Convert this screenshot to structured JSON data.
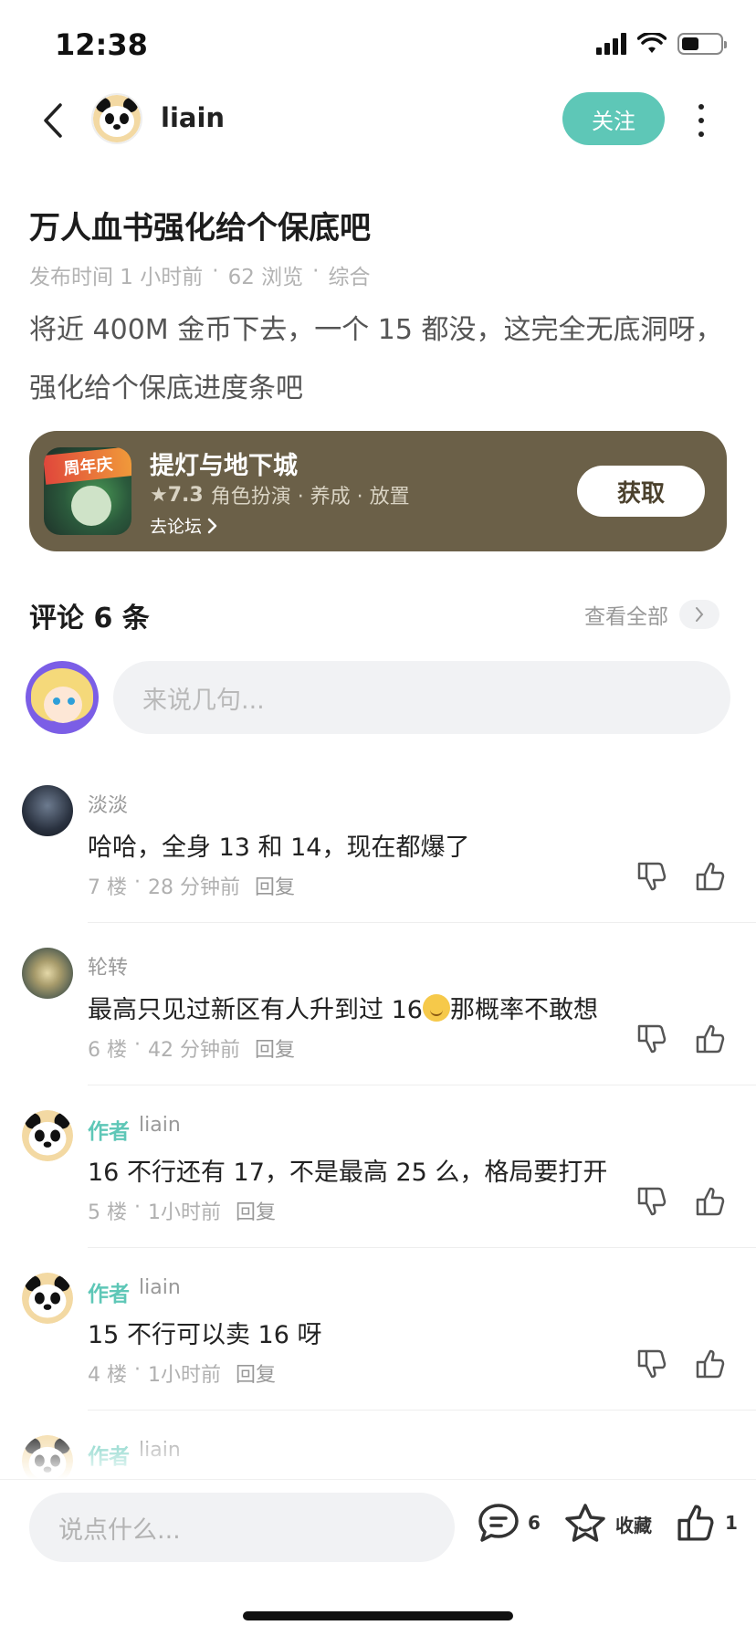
{
  "status_bar": {
    "time": "12:38"
  },
  "header": {
    "author_name": "liain",
    "follow_label": "关注"
  },
  "post": {
    "title": "万人血书强化给个保底吧",
    "meta": {
      "published": "发布时间 1 小时前",
      "views": "62 浏览",
      "category": "综合",
      "separator": "·"
    },
    "body": "将近 400M 金币下去，一个 15 都没，这完全无底洞呀，强化给个保底进度条吧"
  },
  "game_card": {
    "icon_badge": "周年庆",
    "name": "提灯与地下城",
    "rating": "★7.3",
    "tags": "角色扮演 · 养成 · 放置",
    "forum_link": "去论坛",
    "get_label": "获取",
    "background_color": "#6b6048"
  },
  "comments_section": {
    "title": "评论 6 条",
    "view_all": "查看全部",
    "input_placeholder": "来说几句..."
  },
  "comments": [
    {
      "name": "淡淡",
      "is_author": false,
      "text": "哈哈，全身 13 和 14，现在都爆了",
      "floor": "7 楼",
      "time": "28 分钟前",
      "reply": "回复"
    },
    {
      "name": "轮转",
      "is_author": false,
      "text_before": "最高只见过新区有人升到过 16",
      "text_after": "那概率不敢想",
      "floor": "6 楼",
      "time": "42 分钟前",
      "reply": "回复"
    },
    {
      "author_tag": "作者",
      "name": "liain",
      "is_author": true,
      "text": "16 不行还有 17，不是最高 25 么，格局要打开",
      "floor": "5 楼",
      "time": "1小时前",
      "reply": "回复"
    },
    {
      "author_tag": "作者",
      "name": "liain",
      "is_author": true,
      "text": "15 不行可以卖 16 呀",
      "floor": "4 楼",
      "time": "1小时前",
      "reply": "回复"
    },
    {
      "author_tag": "作者",
      "name": "liain",
      "is_author": true
    }
  ],
  "bottom_bar": {
    "placeholder": "说点什么...",
    "comment_count": "6",
    "favorite_label": "收藏",
    "like_count": "1"
  },
  "colors": {
    "accent": "#5ec7b7",
    "input_bg": "#f1f2f4"
  }
}
